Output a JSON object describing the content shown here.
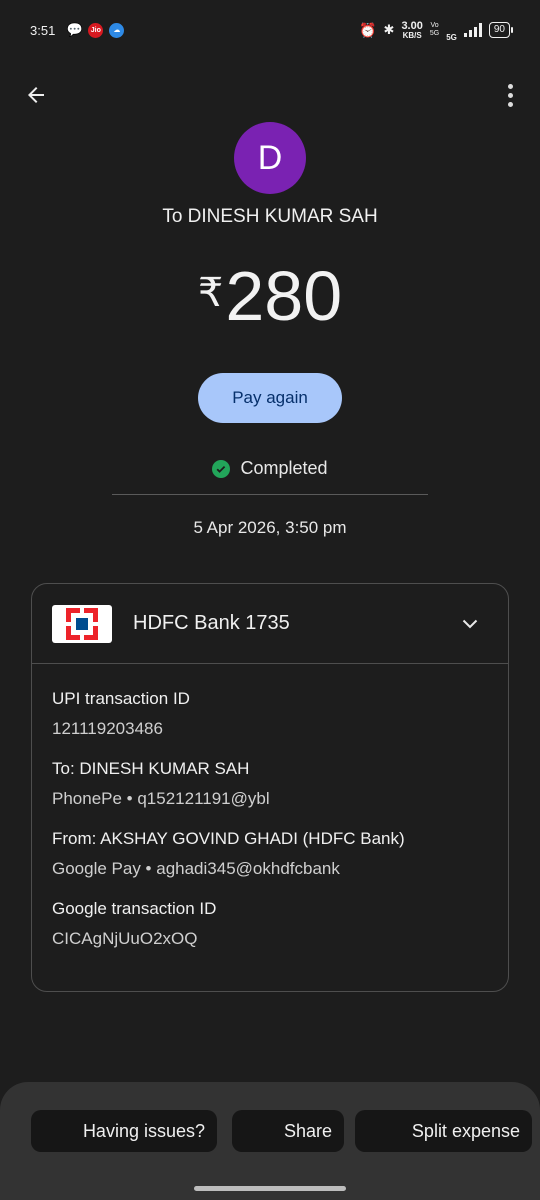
{
  "status_bar": {
    "time": "3:51",
    "jio_label": "Jio",
    "speed_value": "3.00",
    "speed_unit": "KB/S",
    "volte_top": "Vo",
    "volte_bottom": "5G",
    "network": "5G",
    "battery": "90"
  },
  "header": {
    "back_icon": "arrow-left-icon",
    "menu_icon": "more-vert-icon"
  },
  "payee": {
    "avatar_initial": "D",
    "avatar_color": "#7a22b2",
    "title": "To DINESH KUMAR SAH"
  },
  "amount": {
    "currency": "₹",
    "value": "280"
  },
  "pay_again_label": "Pay again",
  "status": {
    "text": "Completed",
    "color": "#22a55a"
  },
  "datetime": "5 Apr 2026, 3:50 pm",
  "card": {
    "bank_name": "HDFC Bank 1735",
    "details": [
      {
        "label": "UPI transaction ID",
        "value": "121119203486"
      },
      {
        "label": "To: DINESH KUMAR SAH",
        "value": "PhonePe • q152121191@ybl"
      },
      {
        "label": "From: AKSHAY GOVIND GHADI (HDFC Bank)",
        "value": "Google Pay • aghadi345@okhdfcbank"
      },
      {
        "label": "Google transaction ID",
        "value": "CICAgNjUuO2xOQ"
      }
    ]
  },
  "actions": {
    "having_issues": "Having issues?",
    "share": "Share",
    "split_expense": "Split expense"
  },
  "colors": {
    "accent_button": "#a8c7fa",
    "background": "#1d1d1d",
    "sheet": "#333333"
  }
}
